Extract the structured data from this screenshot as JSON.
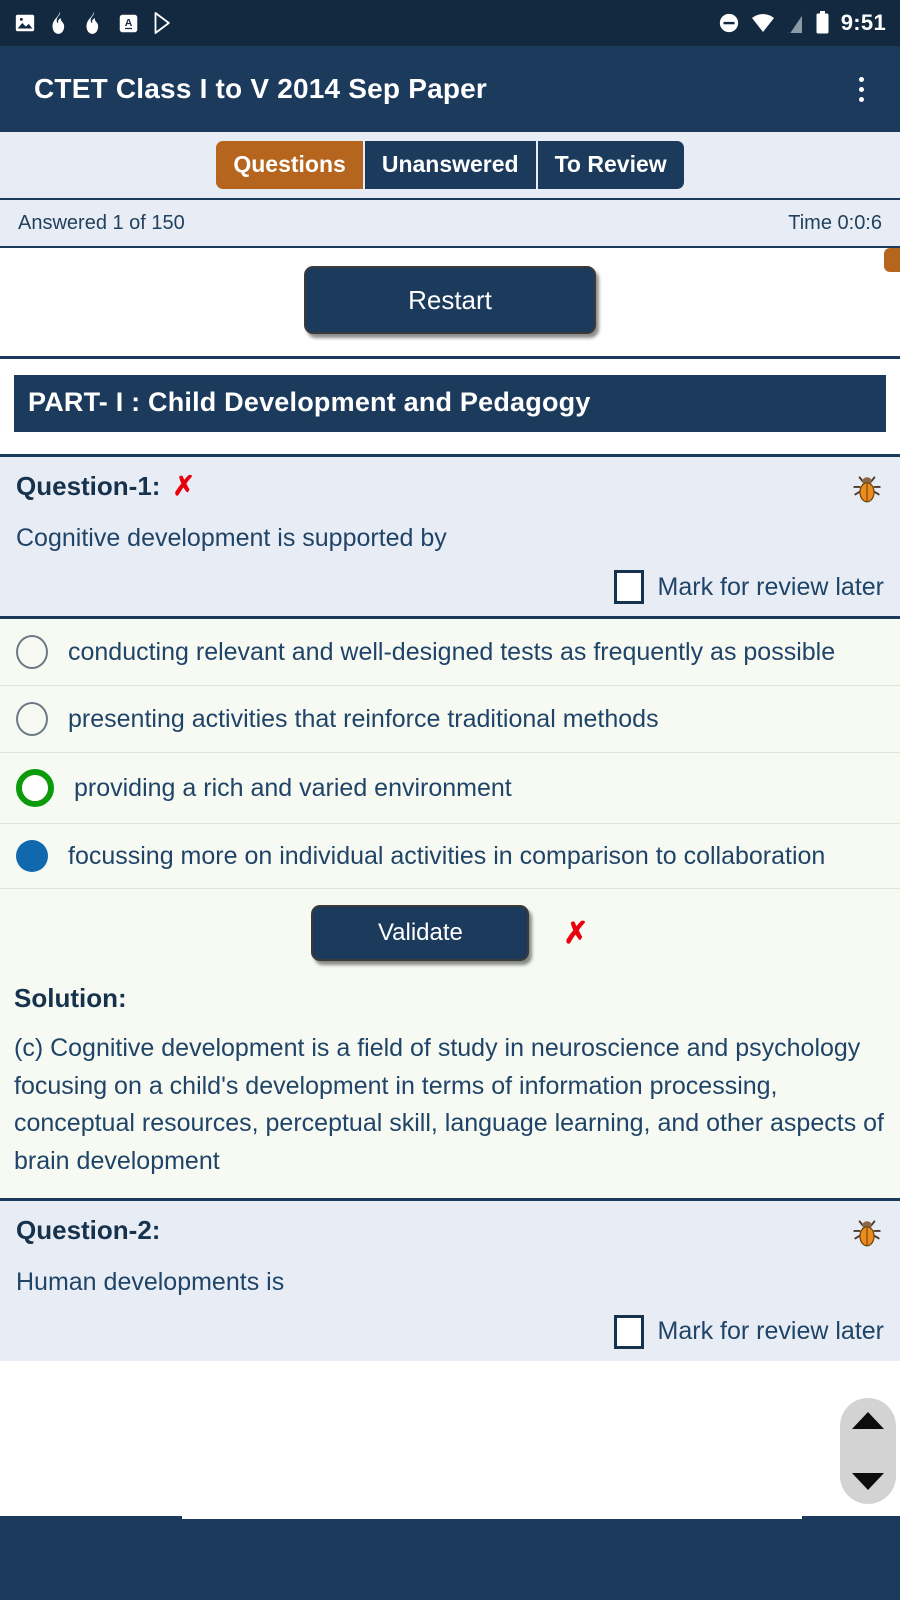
{
  "status_bar": {
    "time": "9:51",
    "left_icons": [
      "image-icon",
      "flame-icon",
      "flame-icon",
      "translate-a-icon",
      "play-store-icon"
    ],
    "right_icons": [
      "do-not-disturb-icon",
      "wifi-icon",
      "signal-off-icon",
      "battery-icon"
    ]
  },
  "app_bar": {
    "title": "CTET Class I to V 2014 Sep Paper",
    "overflow_icon": "kebab-menu-icon"
  },
  "tabs": [
    {
      "label": "Questions",
      "active": true
    },
    {
      "label": "Unanswered",
      "active": false
    },
    {
      "label": "To Review",
      "active": false
    }
  ],
  "status_row": {
    "answered": "Answered 1 of 150",
    "timer": "Time 0:0:6"
  },
  "toolbar": {
    "restart_label": "Restart"
  },
  "part": {
    "heading": "PART- I : Child Development and Pedagogy"
  },
  "questions": [
    {
      "label": "Question-1:",
      "result_mark": "✗",
      "bug_icon": "bug-report-icon",
      "text": "Cognitive development is supported by",
      "mark_review_label": "Mark for review later",
      "mark_review_checked": false,
      "options": [
        {
          "text": "conducting relevant and well-designed tests as frequently as possible",
          "state": "empty"
        },
        {
          "text": "presenting activities that reinforce traditional methods",
          "state": "empty"
        },
        {
          "text": "providing a rich and varied environment",
          "state": "correct"
        },
        {
          "text": "focussing more on individual activities in comparison to collaboration",
          "state": "chosen"
        }
      ],
      "validate_label": "Validate",
      "validate_result_mark": "✗",
      "solution_title": "Solution:",
      "solution_text": "(c) Cognitive development is a field of study in neuroscience and psychology focusing on a child's development in terms of information processing, conceptual resources, perceptual skill, language learning, and other aspects of brain development"
    },
    {
      "label": "Question-2:",
      "bug_icon": "bug-report-icon",
      "text": "Human developments is",
      "mark_review_label": "Mark for review later",
      "mark_review_checked": false
    }
  ],
  "colors": {
    "primary": "#1b3a5c",
    "status_bar": "#12293f",
    "accent_orange": "#b5651d",
    "panel_blue": "#e8edf5",
    "option_bg": "#f7faf3",
    "correct_green": "#0a9a0a",
    "chosen_blue": "#1268ad",
    "wrong_red": "#e8000d",
    "text_blue": "#1f4468"
  },
  "fast_scroll": {
    "up_icon": "triangle-up-icon",
    "down_icon": "triangle-down-icon"
  }
}
